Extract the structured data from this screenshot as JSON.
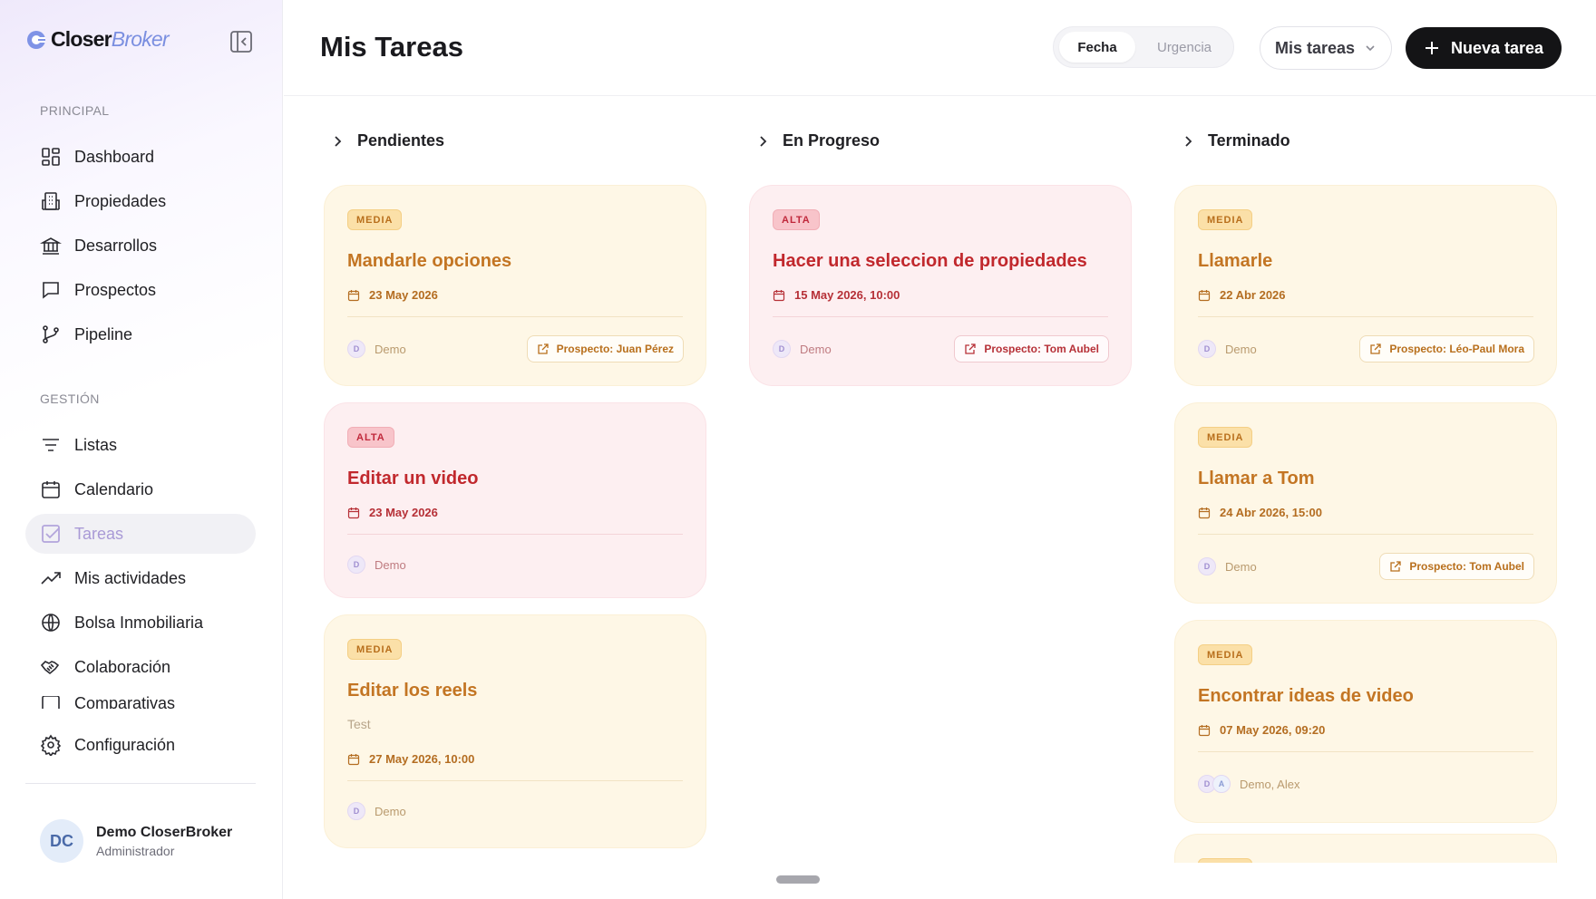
{
  "app": {
    "logo_bold": "Closer",
    "logo_light": "Broker"
  },
  "sidebar": {
    "sections": [
      {
        "label": "PRINCIPAL"
      },
      {
        "label": "GESTIÓN"
      }
    ],
    "items": [
      {
        "label": "Dashboard",
        "icon": "dashboard-icon"
      },
      {
        "label": "Propiedades",
        "icon": "building-icon"
      },
      {
        "label": "Desarrollos",
        "icon": "bank-icon"
      },
      {
        "label": "Prospectos",
        "icon": "chat-icon"
      },
      {
        "label": "Pipeline",
        "icon": "git-branch-icon"
      },
      {
        "label": "Listas",
        "icon": "filter-list-icon"
      },
      {
        "label": "Calendario",
        "icon": "calendar-icon"
      },
      {
        "label": "Tareas",
        "icon": "checkbox-icon",
        "active": true
      },
      {
        "label": "Mis actividades",
        "icon": "trending-up-icon"
      },
      {
        "label": "Bolsa Inmobiliaria",
        "icon": "globe-icon"
      },
      {
        "label": "Colaboración",
        "icon": "handshake-icon"
      },
      {
        "label": "Comparativas",
        "icon": "compare-icon",
        "partially_hidden": true
      },
      {
        "label": "Configuración",
        "icon": "gear-icon"
      }
    ],
    "user": {
      "initials": "DC",
      "name": "Demo CloserBroker",
      "role": "Administrador"
    }
  },
  "header": {
    "title": "Mis Tareas",
    "sort_options": [
      "Fecha",
      "Urgencia"
    ],
    "sort_selected": "Fecha",
    "filter_value": "Mis tareas",
    "new_button": "Nueva tarea"
  },
  "columns": [
    {
      "title": "Pendientes",
      "cards": [
        {
          "priority": "MEDIA",
          "title": "Mandarle opciones",
          "date": "23 May 2026",
          "assignee": "Demo",
          "assignee_initials": [
            "D"
          ],
          "prospect": "Prospecto: Juan Pérez"
        },
        {
          "priority": "ALTA",
          "title": "Editar un video",
          "date": "23 May 2026",
          "assignee": "Demo",
          "assignee_initials": [
            "D"
          ]
        },
        {
          "priority": "MEDIA",
          "title": "Editar los reels",
          "description": "Test",
          "date": "27 May 2026, 10:00",
          "assignee": "Demo",
          "assignee_initials": [
            "D"
          ]
        }
      ]
    },
    {
      "title": "En Progreso",
      "cards": [
        {
          "priority": "ALTA",
          "title": "Hacer una seleccion de propiedades",
          "date": "15 May 2026, 10:00",
          "assignee": "Demo",
          "assignee_initials": [
            "D"
          ],
          "prospect": "Prospecto: Tom Aubel"
        }
      ]
    },
    {
      "title": "Terminado",
      "cards": [
        {
          "priority": "MEDIA",
          "title": "Llamarle",
          "date": "22 Abr 2026",
          "assignee": "Demo",
          "assignee_initials": [
            "D"
          ],
          "prospect": "Prospecto: Léo-Paul Mora"
        },
        {
          "priority": "MEDIA",
          "title": "Llamar a Tom",
          "date": "24 Abr 2026, 15:00",
          "assignee": "Demo",
          "assignee_initials": [
            "D"
          ],
          "prospect": "Prospecto: Tom Aubel"
        },
        {
          "priority": "MEDIA",
          "title": "Encontrar ideas de video",
          "date": "07 May 2026, 09:20",
          "assignee": "Demo, Alex",
          "assignee_initials": [
            "D",
            "A"
          ]
        }
      ]
    }
  ],
  "colors": {
    "media_bg": "#fef7e6",
    "media_text": "#c37523",
    "alta_bg": "#fdeff1",
    "alta_text": "#c1282d",
    "primary_button": "#141416",
    "active_nav": "#a99ad6"
  }
}
